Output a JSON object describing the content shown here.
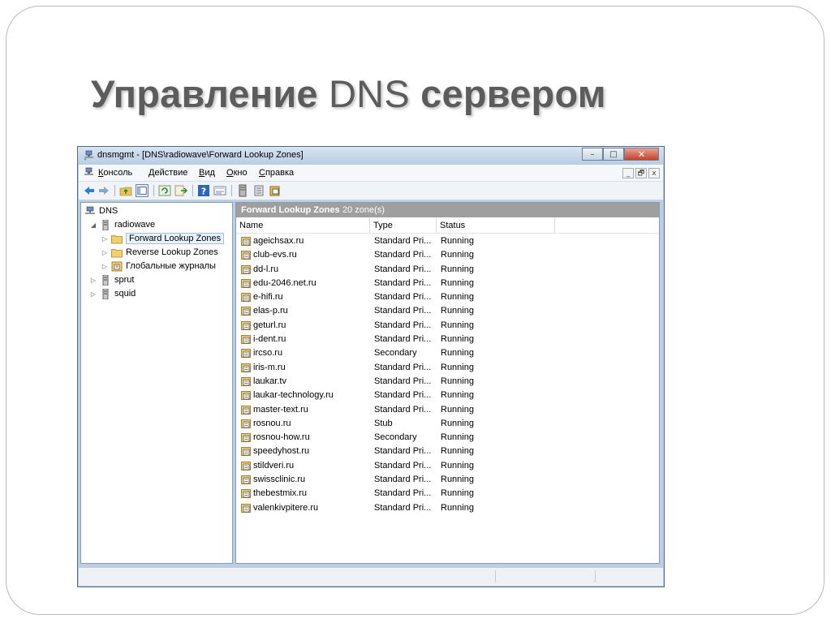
{
  "slide": {
    "title_bold": "Управление",
    "title_light": "DNS",
    "title_end": "сервером"
  },
  "window": {
    "title": "dnsmgmt - [DNS\\radiowave\\Forward Lookup Zones]",
    "caption_min": "–",
    "caption_max": "□",
    "caption_close": "✕"
  },
  "menu": {
    "items": [
      {
        "underline": "К",
        "rest": "онсоль"
      },
      {
        "underline": "Д",
        "rest": "ействие"
      },
      {
        "underline": "В",
        "rest": "ид"
      },
      {
        "underline": "О",
        "rest": "кно"
      },
      {
        "underline": "С",
        "rest": "правка"
      }
    ],
    "mdi_min": "_",
    "mdi_restore": "🗗",
    "mdi_close": "x"
  },
  "tree": {
    "root": "DNS",
    "server": "radiowave",
    "children": [
      "Forward Lookup Zones",
      "Reverse Lookup Zones",
      "Глобальные журналы"
    ],
    "other_servers": [
      "sprut",
      "squid"
    ],
    "selected": "Forward Lookup Zones"
  },
  "details": {
    "header_title": "Forward Lookup Zones",
    "header_count": "20 zone(s)",
    "columns": [
      "Name",
      "Type",
      "Status"
    ],
    "rows": [
      {
        "name": "ageichsax.ru",
        "type": "Standard Pri...",
        "status": "Running"
      },
      {
        "name": "club-evs.ru",
        "type": "Standard Pri...",
        "status": "Running"
      },
      {
        "name": "dd-l.ru",
        "type": "Standard Pri...",
        "status": "Running"
      },
      {
        "name": "edu-2046.net.ru",
        "type": "Standard Pri...",
        "status": "Running"
      },
      {
        "name": "e-hifi.ru",
        "type": "Standard Pri...",
        "status": "Running"
      },
      {
        "name": "elas-p.ru",
        "type": "Standard Pri...",
        "status": "Running"
      },
      {
        "name": "geturl.ru",
        "type": "Standard Pri...",
        "status": "Running"
      },
      {
        "name": "i-dent.ru",
        "type": "Standard Pri...",
        "status": "Running"
      },
      {
        "name": "ircso.ru",
        "type": "Secondary",
        "status": "Running"
      },
      {
        "name": "iris-m.ru",
        "type": "Standard Pri...",
        "status": "Running"
      },
      {
        "name": "laukar.tv",
        "type": "Standard Pri...",
        "status": "Running"
      },
      {
        "name": "laukar-technology.ru",
        "type": "Standard Pri...",
        "status": "Running"
      },
      {
        "name": "master-text.ru",
        "type": "Standard Pri...",
        "status": "Running"
      },
      {
        "name": "rosnou.ru",
        "type": "Stub",
        "status": "Running"
      },
      {
        "name": "rosnou-how.ru",
        "type": "Secondary",
        "status": "Running"
      },
      {
        "name": "speedyhost.ru",
        "type": "Standard Pri...",
        "status": "Running"
      },
      {
        "name": "stildveri.ru",
        "type": "Standard Pri...",
        "status": "Running"
      },
      {
        "name": "swissclinic.ru",
        "type": "Standard Pri...",
        "status": "Running"
      },
      {
        "name": "thebestmix.ru",
        "type": "Standard Pri...",
        "status": "Running"
      },
      {
        "name": "valenkivpitere.ru",
        "type": "Standard Pri...",
        "status": "Running"
      }
    ]
  },
  "colors": {
    "title": "#5c5c5c",
    "header_bar": "#9f9f9f",
    "window_frame": "#b9cfe6"
  }
}
